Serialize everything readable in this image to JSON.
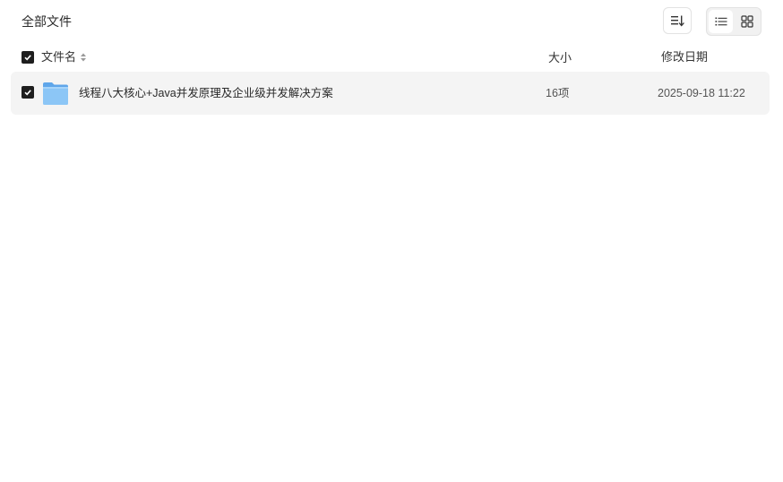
{
  "header": {
    "breadcrumb": "全部文件"
  },
  "toolbar": {
    "sort_icon": "sort-list-icon",
    "view_list_icon": "list-view-icon",
    "view_grid_icon": "grid-view-icon",
    "active_view": "list"
  },
  "columns": {
    "name": "文件名",
    "size": "大小",
    "modified": "修改日期"
  },
  "files": [
    {
      "name": "线程八大核心+Java并发原理及企业级并发解决方案",
      "size": "16项",
      "modified": "2025-09-18 11:22",
      "type_icon": "folder-icon",
      "checked": true
    }
  ],
  "colors": {
    "folder": "#7dbdf4",
    "row_bg": "#f4f4f4",
    "checkbox": "#1e1e1e"
  }
}
